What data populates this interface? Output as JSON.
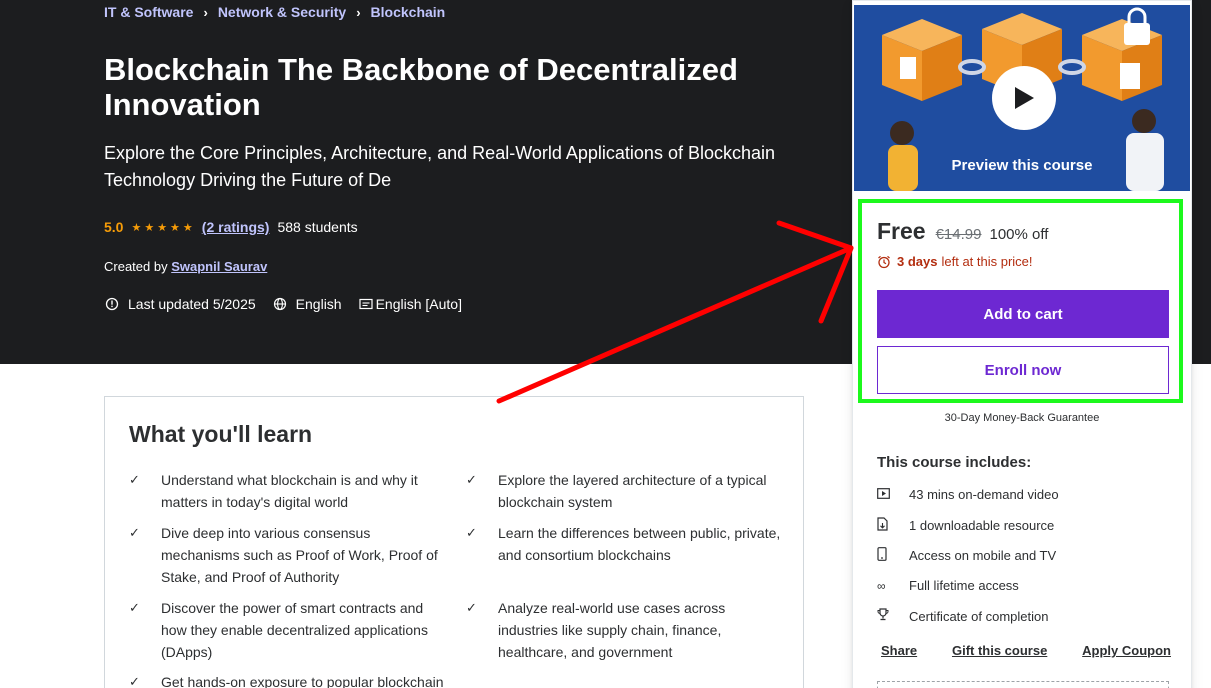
{
  "breadcrumbs": [
    "IT & Software",
    "Network & Security",
    "Blockchain"
  ],
  "course": {
    "title": "Blockchain The Backbone of Decentralized Innovation",
    "subtitle": "Explore the Core Principles, Architecture, and Real-World Applications of Blockchain Technology Driving the Future of De",
    "rating": "5.0",
    "rating_stars": 5,
    "ratings_link": "(2 ratings)",
    "students": "588 students",
    "created_by_label": "Created by",
    "author": "Swapnil Saurav",
    "last_updated": "Last updated 5/2025",
    "language": "English",
    "captions": "English [Auto]"
  },
  "learn": {
    "heading": "What you'll learn",
    "items": [
      "Understand what blockchain is and why it matters in today's digital world",
      "Explore the layered architecture of a typical blockchain system",
      "Dive deep into various consensus mechanisms such as Proof of Work, Proof of Stake, and Proof of Authority",
      "Learn the differences between public, private, and consortium blockchains",
      "Discover the power of smart contracts and how they enable decentralized applications (DApps)",
      "Analyze real-world use cases across industries like supply chain, finance, healthcare, and government",
      "Get hands-on exposure to popular blockchain"
    ]
  },
  "card": {
    "preview_label": "Preview this course",
    "price": "Free",
    "original_price": "€14.99",
    "discount": "100% off",
    "timer_bold": "3 days",
    "timer_rest": "left at this price!",
    "add_to_cart": "Add to cart",
    "enroll_now": "Enroll now",
    "guarantee": "30-Day Money-Back Guarantee",
    "includes_heading": "This course includes:",
    "includes": [
      {
        "icon": "video-icon",
        "text": "43 mins on-demand video"
      },
      {
        "icon": "download-file-icon",
        "text": "1 downloadable resource"
      },
      {
        "icon": "mobile-icon",
        "text": "Access on mobile and TV"
      },
      {
        "icon": "infinity-icon",
        "text": "Full lifetime access"
      },
      {
        "icon": "trophy-icon",
        "text": "Certificate of completion"
      }
    ],
    "links": {
      "share": "Share",
      "gift": "Gift this course",
      "coupon": "Apply Coupon"
    }
  },
  "colors": {
    "hero_bg": "#1c1d1f",
    "link_purple": "#c0c4fc",
    "star": "#f69c08",
    "brand": "#6d28d2",
    "timer_red": "#b32d0f",
    "highlight_green": "#1cf91c",
    "annotation_red": "#ff0000"
  }
}
